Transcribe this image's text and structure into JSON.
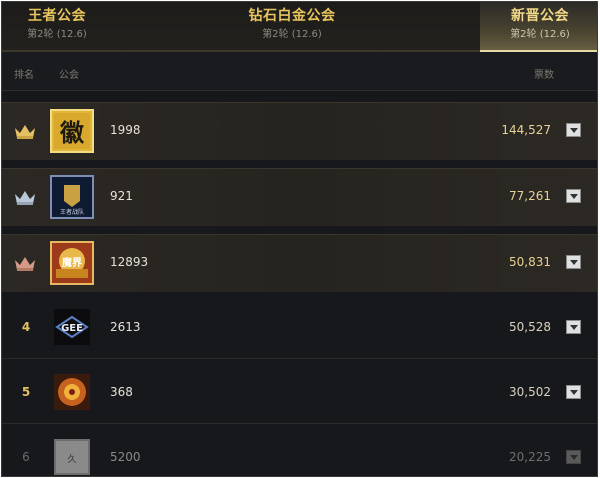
{
  "tabs": [
    {
      "name": "王者公会",
      "sub": "第2轮 (12.6)",
      "active": false
    },
    {
      "name": "钻石白金公会",
      "sub": "第2轮 (12.6)",
      "active": false
    },
    {
      "name": "新晋公会",
      "sub": "第2轮 (12.6)",
      "active": true
    }
  ],
  "header": {
    "rank": "排名",
    "guild": "公会",
    "votes": "票数"
  },
  "rows": [
    {
      "rank": "",
      "crown": "gold-crown-icon",
      "id": "1998",
      "votes": "144,527",
      "logo_text": "徽"
    },
    {
      "rank": "",
      "crown": "silver-crown-icon",
      "id": "921",
      "votes": "77,261",
      "logo_text": "王者战队"
    },
    {
      "rank": "",
      "crown": "bronze-crown-icon",
      "id": "12893",
      "votes": "50,831",
      "logo_text": "魔界"
    },
    {
      "rank": "4",
      "id": "2613",
      "votes": "50,528",
      "logo_text": "GEE"
    },
    {
      "rank": "5",
      "id": "368",
      "votes": "30,502",
      "logo_text": ""
    },
    {
      "rank": "6",
      "id": "5200",
      "votes": "20,225",
      "logo_text": "久"
    }
  ],
  "colors": {
    "gold": "#e3c063",
    "silver": "#b9c7d6",
    "bronze": "#d39b86",
    "background": "#17181b"
  }
}
